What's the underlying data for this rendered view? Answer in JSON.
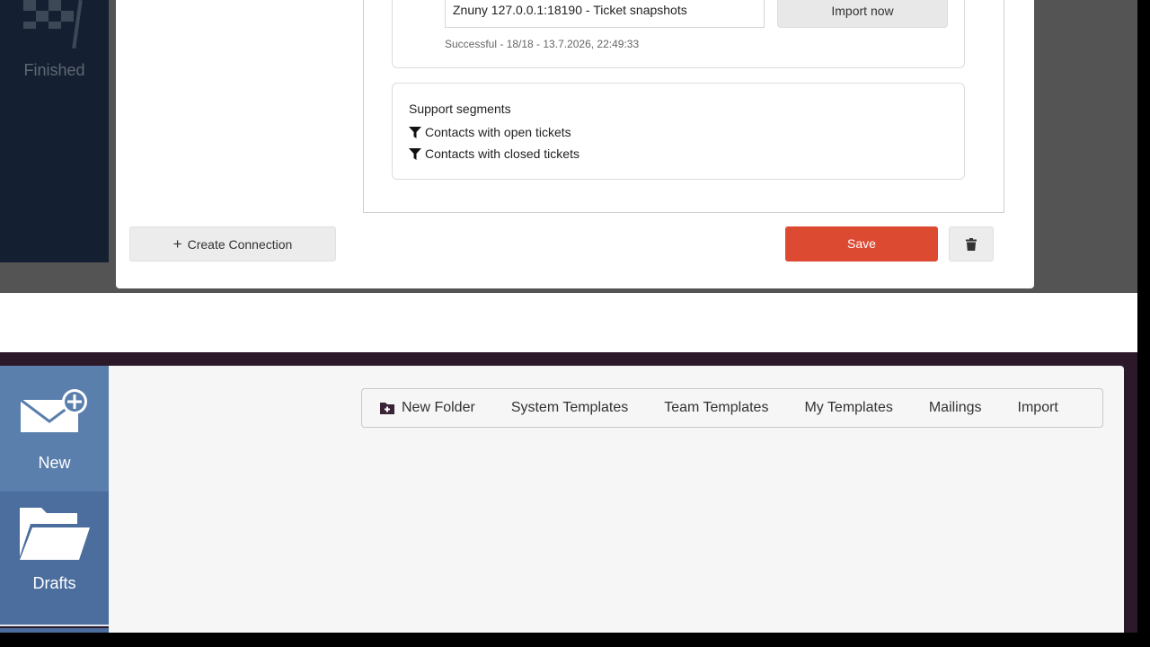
{
  "top_window": {
    "sidebar": {
      "finished_tile": {
        "label": "Finished",
        "icon": "checkered-flag-icon"
      }
    },
    "modal": {
      "snapshot_card": {
        "source_value": "Znuny 127.0.0.1:18190 - Ticket snapshots",
        "import_now_label": "Import now",
        "status_text": "Successful - 18/18 - 13.7.2026, 22:49:33"
      },
      "segments_card": {
        "title": "Support segments",
        "items": [
          {
            "label": "Contacts with open tickets",
            "icon": "filter-icon"
          },
          {
            "label": "Contacts with closed tickets",
            "icon": "filter-icon"
          }
        ]
      },
      "create_connection_label": "Create Connection",
      "save_label": "Save",
      "delete_icon": "trash-icon"
    }
  },
  "bottom_window": {
    "sidebar": {
      "items": [
        {
          "label": "New",
          "icon": "new-mail-icon"
        },
        {
          "label": "Drafts",
          "icon": "folder-open-icon"
        }
      ]
    },
    "toolbar": {
      "items": [
        {
          "label": "New Folder",
          "icon": "new-folder-icon"
        },
        {
          "label": "System Templates"
        },
        {
          "label": "Team Templates"
        },
        {
          "label": "My Templates"
        },
        {
          "label": "Mailings"
        },
        {
          "label": "Import"
        }
      ]
    }
  },
  "colors": {
    "save_button": "#dd4a32",
    "sidebar_new_tile": "#5a7fad",
    "sidebar_drafts_tile": "#4b6e9e",
    "top_sidebar": "#142032",
    "bottom_frame": "#2b1828"
  }
}
